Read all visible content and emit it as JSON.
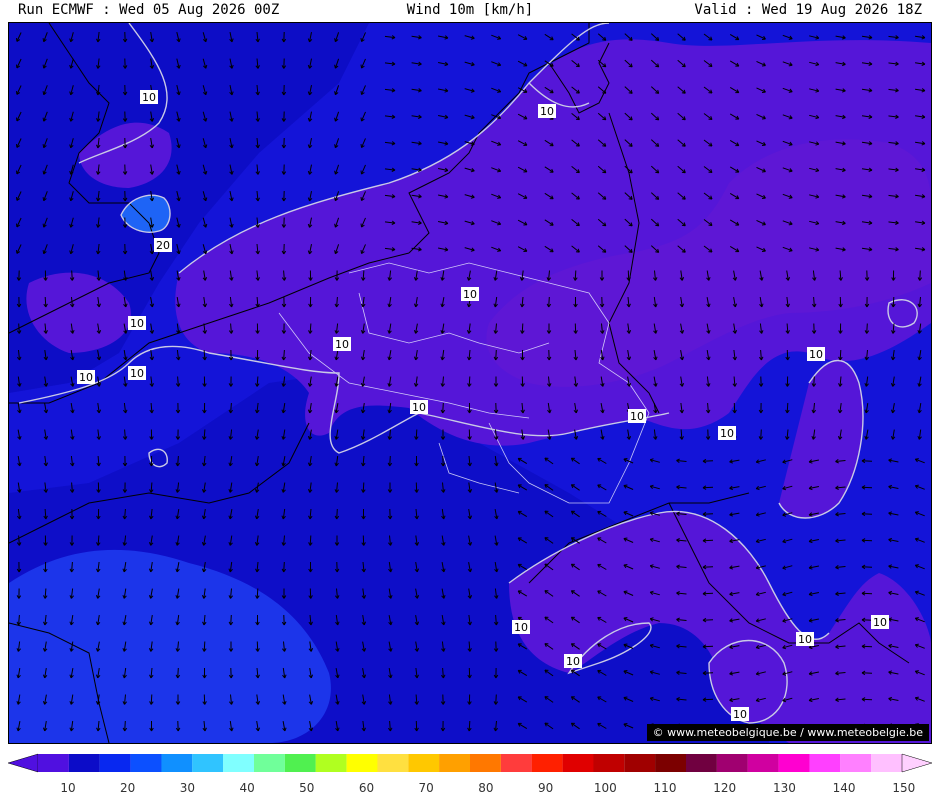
{
  "header": {
    "run": "Run ECMWF : Wed 05 Aug 2026 00Z",
    "field": "Wind 10m [km/h]",
    "valid": "Valid : Wed 19 Aug 2026 18Z"
  },
  "credit": "© www.meteobelgique.be / www.meteobelgie.be",
  "legend": {
    "tick_labels": [
      "10",
      "20",
      "30",
      "40",
      "50",
      "60",
      "70",
      "80",
      "90",
      "100",
      "110",
      "120",
      "130",
      "140",
      "150"
    ],
    "colors": [
      "#5010e0",
      "#0c0cc8",
      "#0828f0",
      "#0c50ff",
      "#1090ff",
      "#30c4ff",
      "#80ffff",
      "#70ff9a",
      "#50f050",
      "#b0ff20",
      "#ffff00",
      "#ffe040",
      "#ffc800",
      "#ffa000",
      "#ff7800",
      "#ff3c3c",
      "#ff2000",
      "#e00000",
      "#c00000",
      "#a00000",
      "#7c0000",
      "#700040",
      "#a00070",
      "#d000a0",
      "#ff00d0",
      "#ff40ff",
      "#ff80ff",
      "#ffc0ff"
    ]
  },
  "contour_labels": [
    "10",
    "10",
    "20",
    "10",
    "10",
    "10",
    "10",
    "10",
    "10",
    "10",
    "10",
    "10",
    "10",
    "10",
    "10",
    "10",
    "10",
    "10"
  ],
  "wind_field": {
    "units": "km/h",
    "background_color": "#1a1ae0",
    "purple_zone_color": "#5a1ad6",
    "light_zone_color": "#1e5cf4",
    "arrow_color": "#000000"
  }
}
